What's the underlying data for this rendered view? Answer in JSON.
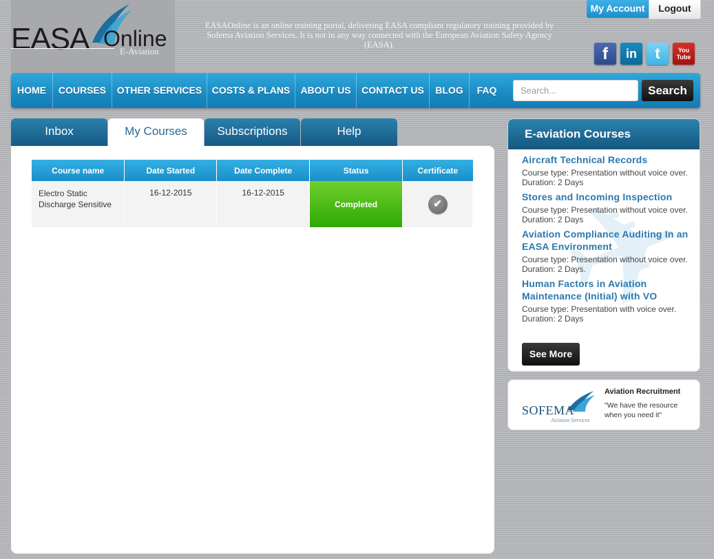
{
  "header": {
    "logo_main": "EASA",
    "logo_online": "Online",
    "logo_sub": "E-Aviation",
    "disclaimer": "EASAOnline is an online training portal, delivering EASA compliant regulatory training provided by Sofema Aviation Services. It is not in any way connected with the European Aviation Safety Agency (EASA).",
    "my_account": "My Account",
    "logout": "Logout",
    "social": {
      "facebook": "f",
      "linkedin": "in",
      "twitter": "t",
      "youtube_top": "You",
      "youtube_bottom": "Tube"
    }
  },
  "nav": {
    "items": [
      "HOME",
      "COURSES",
      "OTHER SERVICES",
      "COSTS & PLANS",
      "ABOUT US",
      "CONTACT US",
      "BLOG",
      "FAQ"
    ],
    "search_placeholder": "Search...",
    "search_button": "Search"
  },
  "tabs": [
    "Inbox",
    "My Courses",
    "Subscriptions",
    "Help"
  ],
  "active_tab": "My Courses",
  "table": {
    "headers": [
      "Course name",
      "Date Started",
      "Date Complete",
      "Status",
      "Certificate"
    ],
    "rows": [
      {
        "name": "Electro Static Discharge Sensitive",
        "date_started": "16-12-2015",
        "date_complete": "16-12-2015",
        "status": "Completed",
        "certificate_icon": "check-icon"
      }
    ]
  },
  "sidebar": {
    "title": "E-aviation Courses",
    "courses": [
      {
        "title": "Aircraft Technical Records",
        "desc": "Course type: Presentation without voice over. Duration: 2 Days"
      },
      {
        "title": "Stores and Incoming Inspection",
        "desc": "Course type: Presentation without voice over. Duration: 2 Days"
      },
      {
        "title": "Aviation Compliance Auditing In an EASA Environment",
        "desc": "Course type: Presentation without voice over. Duration: 2 Days."
      },
      {
        "title": "Human Factors in Aviation Maintenance (Initial) with VO",
        "desc": "Course type: Presentation with voice over. Duration: 2 Days"
      }
    ],
    "see_more": "See More"
  },
  "ad": {
    "logo_word": "SOFEMA",
    "logo_sub": "Aviation Services",
    "title": "Aviation Recruitment",
    "text": "\"We have the resource when you need it\""
  },
  "colors": {
    "nav_blue": "#1a8ac3",
    "tab_blue": "#155a85",
    "status_green": "#2ea806",
    "link_blue": "#2b78ad"
  }
}
